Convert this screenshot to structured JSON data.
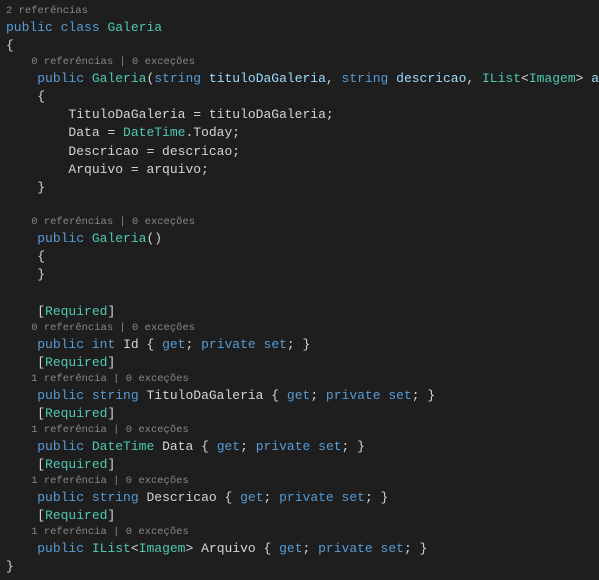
{
  "codelens": {
    "class": "2 referências",
    "ctor1": "0 referências | 0 exceções",
    "ctor2": "0 referências | 0 exceções",
    "id": "0 referências | 0 exceções",
    "titulo": "1 referência | 0 exceções",
    "data": "1 referência | 0 exceções",
    "descricao": "1 referência | 0 exceções",
    "arquivo": "1 referência | 0 exceções"
  },
  "kw": {
    "public": "public",
    "class": "class",
    "string": "string",
    "int": "int",
    "get": "get",
    "set": "set",
    "private": "private"
  },
  "type": {
    "className": "Galeria",
    "IList": "IList",
    "Imagem": "Imagem",
    "DateTime": "DateTime",
    "Required": "Required"
  },
  "ctor1": {
    "param1": "tituloDaGaleria",
    "param2": "descricao",
    "param3": "arquivo",
    "body1_lhs": "TituloDaGaleria",
    "body1_rhs": "tituloDaGaleria",
    "body2_lhs": "Data",
    "body2_rhs": "Today",
    "body3_lhs": "Descricao",
    "body3_rhs": "descricao",
    "body4_lhs": "Arquivo",
    "body4_rhs": "arquivo"
  },
  "props": {
    "Id": "Id",
    "TituloDaGaleria": "TituloDaGaleria",
    "Data": "Data",
    "Descricao": "Descricao",
    "Arquivo": "Arquivo"
  }
}
